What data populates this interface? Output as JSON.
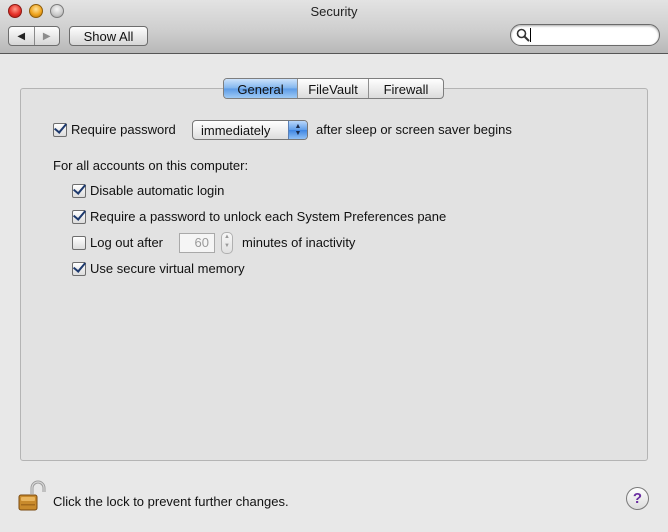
{
  "window": {
    "title": "Security"
  },
  "toolbar": {
    "back_icon": "◀",
    "forward_icon": "▶",
    "show_all_label": "Show All",
    "search_value": ""
  },
  "tabs": [
    {
      "label": "General",
      "selected": true
    },
    {
      "label": "FileVault",
      "selected": false
    },
    {
      "label": "Firewall",
      "selected": false
    }
  ],
  "general": {
    "require_password": {
      "label": "Require password",
      "checked": true,
      "popup_value": "immediately",
      "suffix": "after sleep or screen saver begins"
    },
    "accounts_heading": "For all accounts on this computer:",
    "options": [
      {
        "label": "Disable automatic login",
        "checked": true
      },
      {
        "label": "Require a password to unlock each System Preferences pane",
        "checked": true
      },
      {
        "label": "Log out after",
        "checked": false,
        "minutes": "60",
        "suffix": "minutes of inactivity"
      },
      {
        "label": "Use secure virtual memory",
        "checked": true
      }
    ]
  },
  "footer": {
    "lock_text": "Click the lock to prevent further changes.",
    "help_label": "?"
  },
  "colors": {
    "selected_tab": "#7fb4ee",
    "checkmark": "#1e3a6e",
    "help_glyph": "#6a2da0"
  }
}
